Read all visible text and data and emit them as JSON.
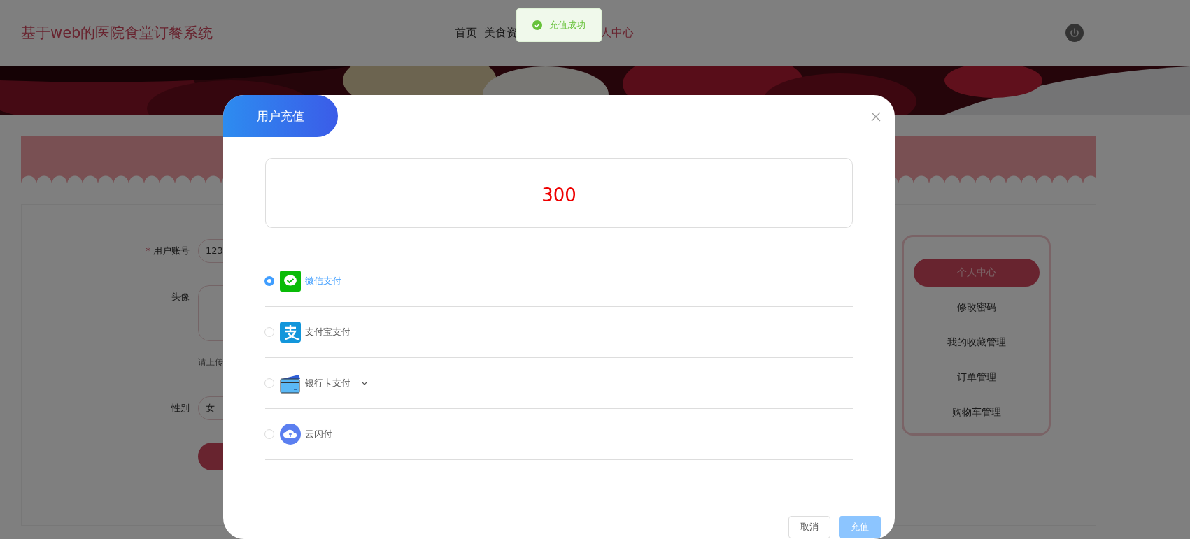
{
  "header": {
    "title": "基于web的医院食堂订餐系统",
    "nav": [
      {
        "label": "首页",
        "selected": false
      },
      {
        "label": "美食资",
        "selected": false
      },
      {
        "label": "人中心",
        "selected": true
      }
    ]
  },
  "form": {
    "fields": [
      {
        "kind": "text",
        "label": "用户账号",
        "required_mark": "*",
        "value": "123"
      },
      {
        "kind": "upload",
        "label": "头像"
      },
      {
        "kind": "hint",
        "text": "请上传"
      },
      {
        "kind": "text",
        "label": "性别",
        "value": "女"
      },
      {
        "kind": "button"
      }
    ]
  },
  "sidebar": {
    "items": [
      {
        "label": "个人中心",
        "selected": true
      },
      {
        "label": "修改密码",
        "selected": false
      },
      {
        "label": "我的收藏管理",
        "selected": false
      },
      {
        "label": "订单管理",
        "selected": false
      },
      {
        "label": "购物车管理",
        "selected": false
      }
    ]
  },
  "dialog": {
    "title": "用户充值",
    "amount": "300",
    "payment_methods": [
      {
        "label": "微信支付",
        "kind": "wechat",
        "selected": true,
        "has_dropdown": false
      },
      {
        "label": "支付宝支付",
        "kind": "alipay",
        "selected": false,
        "has_dropdown": false
      },
      {
        "label": "银行卡支付",
        "kind": "bank",
        "selected": false,
        "has_dropdown": true
      },
      {
        "label": "云闪付",
        "kind": "cloudpay",
        "selected": false,
        "has_dropdown": false
      }
    ],
    "buttons": [
      {
        "label": "取消",
        "kind": "default"
      },
      {
        "label": "充值",
        "kind": "primary"
      }
    ]
  },
  "toast": {
    "message": "充值成功"
  }
}
